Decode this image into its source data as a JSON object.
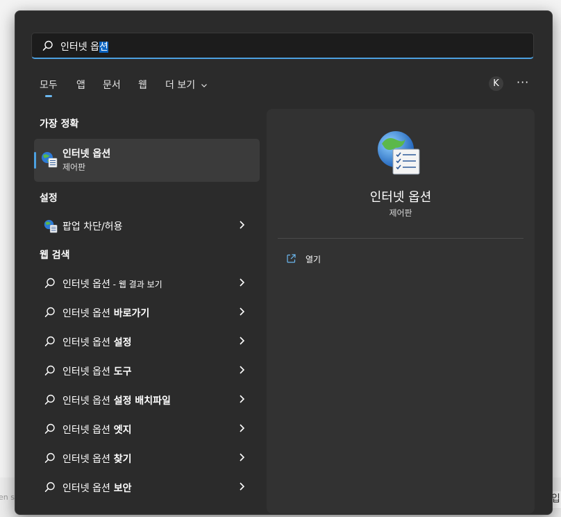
{
  "background": {
    "left_text": "en s",
    "right_text": "입"
  },
  "search": {
    "text_plain": "인터넷 옵",
    "text_selected": "션"
  },
  "tabs": [
    {
      "label": "모두"
    },
    {
      "label": "앱"
    },
    {
      "label": "문서"
    },
    {
      "label": "웹"
    },
    {
      "label": "더 보기"
    }
  ],
  "account": {
    "initial": "K",
    "more_label": "···"
  },
  "sections": {
    "best": "가장 정확",
    "settings": "설정",
    "web": "웹 검색"
  },
  "best_match": {
    "title": "인터넷 옵션",
    "subtitle": "제어판"
  },
  "settings_items": [
    {
      "label": "팝업 차단/허용"
    }
  ],
  "web_items": [
    {
      "prefix": "인터넷 옵션",
      "suffix": " - 웹 결과 보기"
    },
    {
      "prefix": "인터넷 옵션",
      "suffix": " 바로가기"
    },
    {
      "prefix": "인터넷 옵션",
      "suffix": " 설정"
    },
    {
      "prefix": "인터넷 옵션",
      "suffix": " 도구"
    },
    {
      "prefix": "인터넷 옵션",
      "suffix": " 설정 배치파일"
    },
    {
      "prefix": "인터넷 옵션",
      "suffix": " 엣지"
    },
    {
      "prefix": "인터넷 옵션",
      "suffix": " 찾기"
    },
    {
      "prefix": "인터넷 옵션",
      "suffix": " 보안"
    }
  ],
  "detail": {
    "title": "인터넷 옵션",
    "subtitle": "제어판",
    "action_open": "열기"
  },
  "colors": {
    "accent": "#4ca0e0",
    "panel": "#2b2b2b",
    "detail": "#323232"
  },
  "icons": {
    "search": "search-icon",
    "internet_options": "internet-options-icon",
    "chevron": "chevron-right-icon",
    "open": "open-external-icon"
  }
}
